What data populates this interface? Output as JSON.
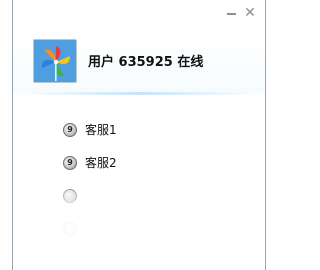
{
  "window": {
    "minimize_glyph": "",
    "close_glyph": "✕"
  },
  "header": {
    "avatar_icon": "pinwheel-avatar-icon",
    "status_text": "用户 635925 在线"
  },
  "contacts": [
    {
      "label": "客服1",
      "icon": "service-icon",
      "icon_glyph": "9"
    },
    {
      "label": "客服2",
      "icon": "service-icon",
      "icon_glyph": "9"
    },
    {
      "label": "",
      "icon": "service-icon",
      "icon_glyph": ""
    },
    {
      "label": "",
      "icon": "service-icon",
      "icon_glyph": ""
    }
  ],
  "colors": {
    "accent": "#c8e4f6",
    "border": "#9aa4ad"
  }
}
